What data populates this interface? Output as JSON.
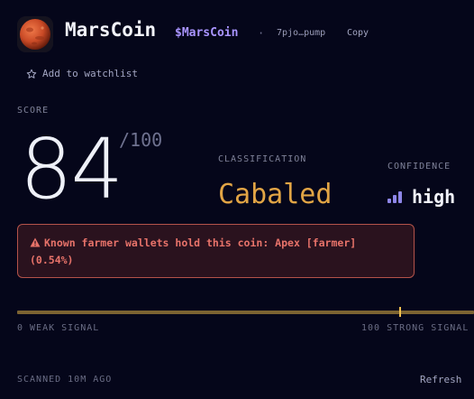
{
  "header": {
    "coin_name": "MarsCoin",
    "ticker": "$MarsCoin",
    "separator": "·",
    "address": "7pjo…pump",
    "copy_label": "Copy",
    "avatar_icon": "mars-planet-icon"
  },
  "watchlist": {
    "label": "Add to watchlist",
    "icon": "star-outline-icon"
  },
  "score": {
    "label": "SCORE",
    "value": "84",
    "max": "/100"
  },
  "classification": {
    "label": "CLASSIFICATION",
    "value": "Cabaled",
    "color": "#e2a545"
  },
  "confidence": {
    "label": "CONFIDENCE",
    "value": "high",
    "icon": "signal-bars-icon"
  },
  "alert": {
    "icon": "warning-icon",
    "text": "Known farmer wallets hold this coin: Apex [farmer] (0.54%)",
    "color": "#e8736a"
  },
  "signal_scale": {
    "left_label": "0 WEAK SIGNAL",
    "right_label": "100 STRONG SIGNAL",
    "min": 0,
    "max": 100,
    "value": 84
  },
  "footer": {
    "scanned": "SCANNED 10M AGO",
    "refresh_label": "Refresh"
  }
}
